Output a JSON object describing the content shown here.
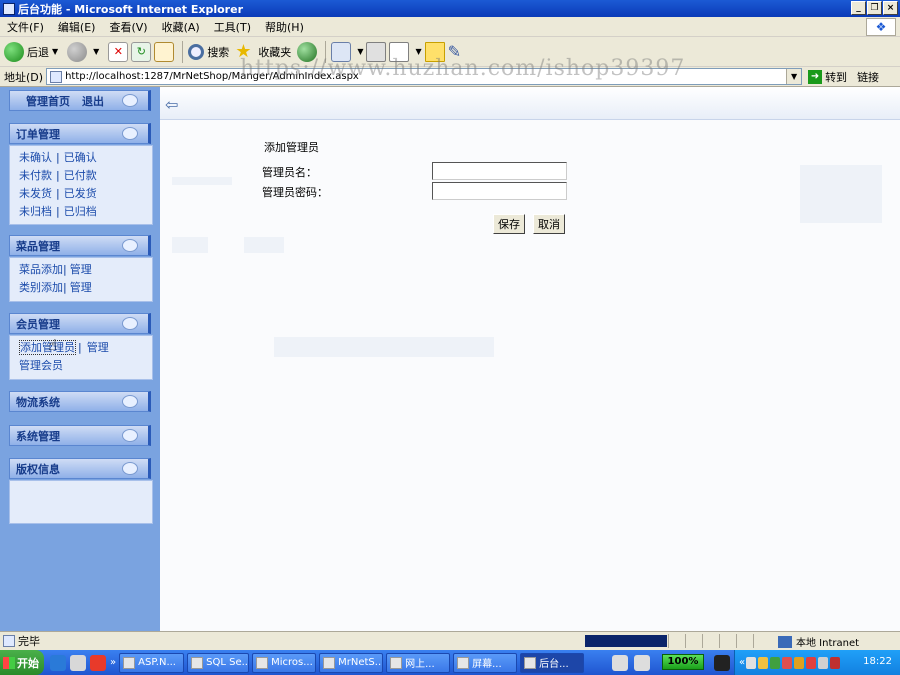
{
  "window": {
    "title": "后台功能 - Microsoft Internet Explorer",
    "buttons": [
      "_",
      "❐",
      "×"
    ]
  },
  "menubar": {
    "items": [
      "文件(F)",
      "编辑(E)",
      "查看(V)",
      "收藏(A)",
      "工具(T)",
      "帮助(H)"
    ]
  },
  "toolbar": {
    "back_label": "后退",
    "search_label": "搜索",
    "favorites_label": "收藏夹"
  },
  "addressbar": {
    "label": "地址(D)",
    "url": "http://localhost:1287/MrNetShop/Manger/AdminIndex.aspx",
    "go_label": "转到",
    "links_label": "链接"
  },
  "watermark": "https://www.huzhan.com/ishop39397",
  "sidebar": {
    "top": {
      "home": "管理首页",
      "logout": "退出"
    },
    "sections": [
      {
        "title": "订单管理",
        "rows": [
          [
            "未确认",
            "已确认"
          ],
          [
            "未付款",
            "已付款"
          ],
          [
            "未发货",
            "已发货"
          ],
          [
            "未归档",
            "已归档"
          ]
        ]
      },
      {
        "title": "菜品管理",
        "rows": [
          [
            "菜品添加",
            "管理"
          ],
          [
            "类别添加",
            "管理"
          ]
        ]
      },
      {
        "title": "会员管理",
        "rows": [
          [
            "添加管理员",
            "管理"
          ],
          [
            "管理会员"
          ]
        ]
      },
      {
        "title": "物流系统"
      },
      {
        "title": "系统管理"
      },
      {
        "title": "版权信息"
      }
    ]
  },
  "form": {
    "title": "添加管理员",
    "username_label": "管理员名：",
    "password_label": "管理员密码：",
    "username_value": "",
    "password_value": "",
    "save_label": "保存",
    "cancel_label": "取消"
  },
  "statusbar": {
    "text": "完毕",
    "zone": "本地 Intranet"
  },
  "taskbar": {
    "start_label": "开始",
    "tasks": [
      "ASP.N...",
      "SQL Se...",
      "Micros...",
      "MrNetS...",
      "网上...",
      "屏幕...",
      "后台..."
    ],
    "zoom": "100%",
    "clock": "18:22"
  }
}
